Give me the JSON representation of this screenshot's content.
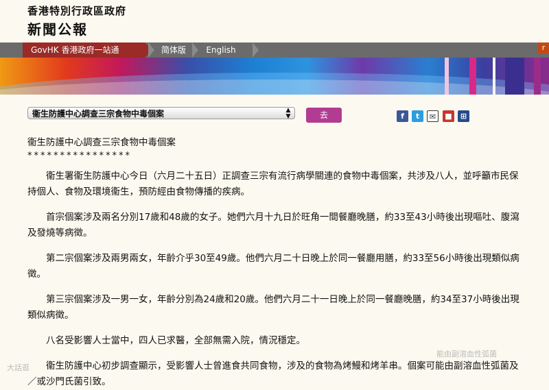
{
  "header": {
    "site_name": "香港特別行政區政府",
    "section": "新聞公報"
  },
  "nav": {
    "govhk": "GovHK 香港政府一站通",
    "simplified": "简体版",
    "english": "English",
    "corner": "r"
  },
  "toolbar": {
    "select_value": "衞生防護中心調查三宗食物中毒個案",
    "go_label": "去"
  },
  "share_icons": [
    "facebook-icon",
    "twitter-icon",
    "email-icon",
    "print-icon",
    "share-icon"
  ],
  "colors": {
    "govhk_tab": "#9a2b27",
    "go_button": "#b33c93"
  },
  "article": {
    "title": "衞生防護中心調查三宗食物中毒個案",
    "stars": "****************",
    "paragraphs": [
      "衞生署衞生防護中心今日（六月二十五日）正調查三宗有流行病學關連的食物中毒個案，共涉及八人，並呼籲市民保持個人、食物及環境衞生，預防經由食物傳播的疾病。",
      "首宗個案涉及兩名分別17歲和48歲的女子。她們六月十九日於旺角一間餐廳晚膳，約33至43小時後出現嘔吐、腹瀉及發燒等病徵。",
      "第二宗個案涉及兩男兩女，年齡介乎30至49歲。他們六月二十日晚上於同一餐廳用膳，約33至56小時後出現類似病徵。",
      "第三宗個案涉及一男一女，年齡分別為24歲和20歲。他們六月二十一日晚上於同一餐廳晚膳，約34至37小時後出現類似病徵。",
      "八名受影響人士當中，四人已求醫，全部無需入院，情況穩定。",
      "衞生防護中心初步調查顯示，受影響人士曾進食共同食物，涉及的食物為烤鰻和烤羊串。個案可能由副溶血性弧菌及／或沙門氏菌引致。"
    ]
  },
  "watermark": {
    "left": "大話逛",
    "right": "能由副溶血性弧菌"
  }
}
